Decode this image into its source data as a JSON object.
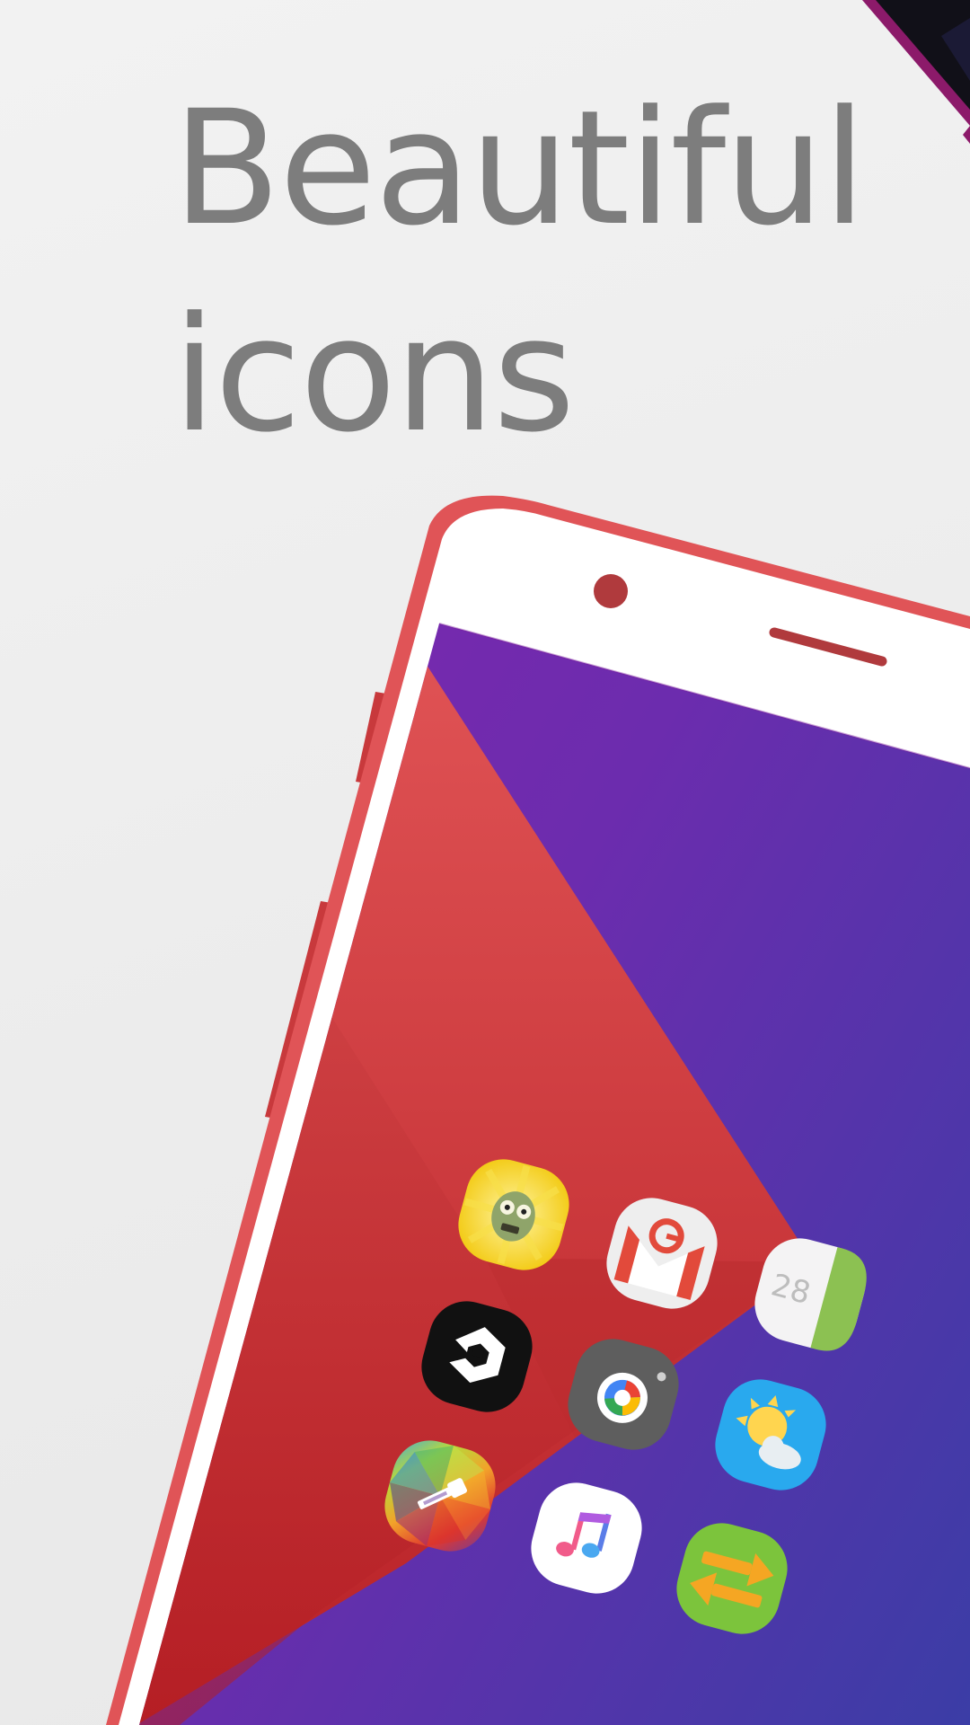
{
  "headline": {
    "line1": "Beautiful",
    "line2": "icons"
  },
  "colors": {
    "background": "#efefef",
    "headline_text": "#7d7d7d",
    "phone_frame": "#e05457",
    "phone_body": "#ffffff",
    "wallpaper_red": "#d94a4d",
    "wallpaper_purple": "#8a25ad",
    "wallpaper_indigo": "#4a39a8"
  },
  "phone": {
    "status": "showcase-mockup",
    "front_camera": "camera-dot-icon",
    "earpiece": "speaker-grille-icon"
  },
  "icons": [
    {
      "name": "zombie-game-icon",
      "color": "#f5d21a"
    },
    {
      "name": "gmail-icon",
      "color": "#eeeeee"
    },
    {
      "name": "calendar-icon",
      "color": "#f4f4f4",
      "label": "28"
    },
    {
      "name": "nine-gag-icon",
      "color": "#111111"
    },
    {
      "name": "camera-icon",
      "color": "#5e5e5e"
    },
    {
      "name": "weather-icon",
      "color": "#29a9ee"
    },
    {
      "name": "color-picker-icon",
      "color": "#e0473f"
    },
    {
      "name": "music-icon",
      "color": "#ffffff"
    },
    {
      "name": "transfer-icon",
      "color": "#7cc43c"
    }
  ]
}
